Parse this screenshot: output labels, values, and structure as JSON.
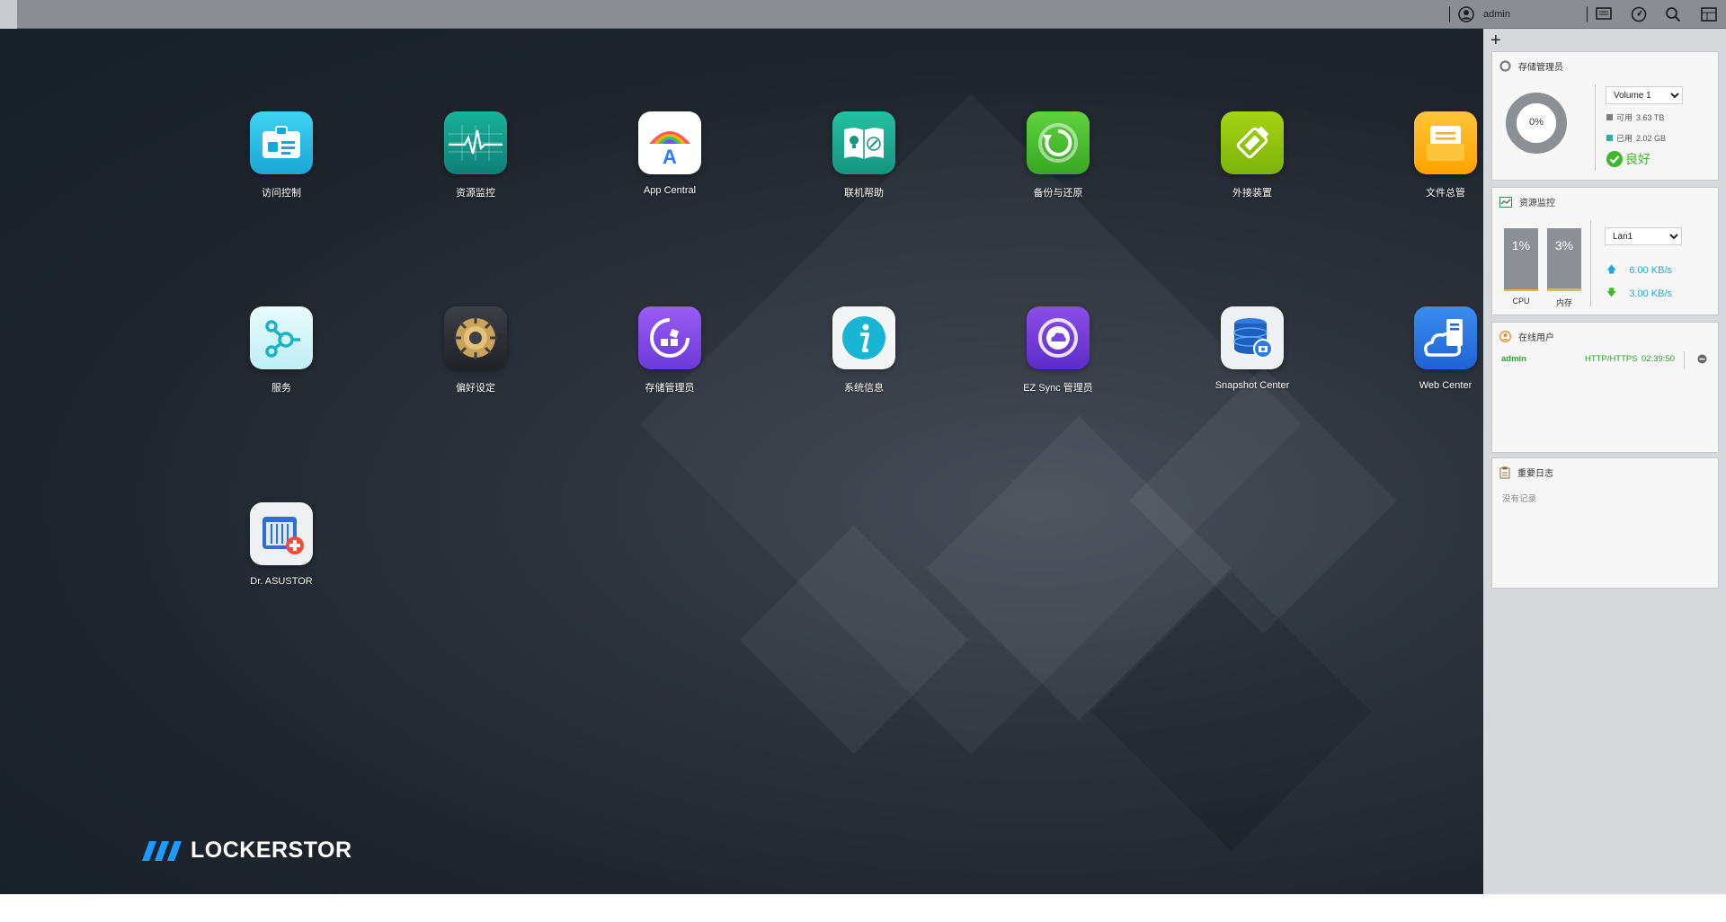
{
  "topbar": {
    "username": "admin",
    "icons": [
      "user-avatar-icon",
      "messages-icon",
      "dashboard-gauge-icon",
      "search-icon",
      "widgets-icon"
    ]
  },
  "desktop": {
    "apps": [
      {
        "name": "app-access-control",
        "label": "访问控制",
        "icon": "id-badge-icon"
      },
      {
        "name": "app-resource-monitor",
        "label": "资源监控",
        "icon": "heartbeat-icon"
      },
      {
        "name": "app-app-central",
        "label": "App Central",
        "icon": "app-store-icon"
      },
      {
        "name": "app-online-help",
        "label": "联机帮助",
        "icon": "help-book-icon"
      },
      {
        "name": "app-backup-restore",
        "label": "备份与还原",
        "icon": "backup-icon"
      },
      {
        "name": "app-external-devices",
        "label": "外接装置",
        "icon": "usb-device-icon"
      },
      {
        "name": "app-file-explorer",
        "label": "文件总管",
        "icon": "folder-icon"
      },
      {
        "name": "app-services",
        "label": "服务",
        "icon": "services-icon"
      },
      {
        "name": "app-preferences",
        "label": "偏好设定",
        "icon": "gear-icon"
      },
      {
        "name": "app-storage-manager",
        "label": "存储管理员",
        "icon": "storage-icon"
      },
      {
        "name": "app-system-info",
        "label": "系统信息",
        "icon": "info-icon"
      },
      {
        "name": "app-ez-sync",
        "label": "EZ Sync 管理员",
        "icon": "cloud-sync-icon"
      },
      {
        "name": "app-snapshot-center",
        "label": "Snapshot Center",
        "icon": "snapshot-database-icon"
      },
      {
        "name": "app-web-center",
        "label": "Web Center",
        "icon": "web-server-icon"
      },
      {
        "name": "app-dr-asustor",
        "label": "Dr. ASUSTOR",
        "icon": "nas-health-icon"
      }
    ],
    "logo_text": "LOCKERSTOR"
  },
  "widgets": {
    "storage": {
      "title": "存储管理员",
      "volume_select": "Volume 1",
      "usage_percent": "0%",
      "available_label": "可用",
      "available_value": "3.63 TB",
      "used_label": "已用",
      "used_value": "2.02 GB",
      "status": "良好",
      "color_available": "#7b7e82",
      "color_used": "#1fb5a0",
      "color_status": "#42b72a"
    },
    "resource": {
      "title": "资源监控",
      "cpu_value": "1%",
      "cpu_label": "CPU",
      "mem_value": "3%",
      "mem_label": "内存",
      "lan_select": "Lan1",
      "upload": "6.00 KB/s",
      "download": "3.00 KB/s",
      "color_up": "#20a8d8",
      "color_down": "#42b72a"
    },
    "online_users": {
      "title": "在线用户",
      "rows": [
        {
          "user": "admin",
          "protocol": "HTTP/HTTPS",
          "time": "02:39:50"
        }
      ]
    },
    "logs": {
      "title": "重要日志",
      "empty_text": "没有记录"
    }
  }
}
